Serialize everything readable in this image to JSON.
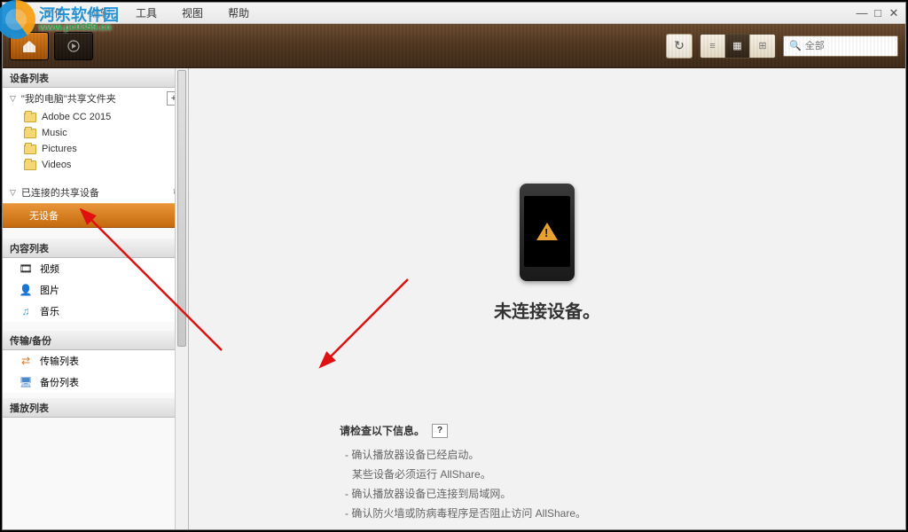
{
  "watermark": {
    "title": "河东软件园",
    "url": "www.pc0359.cn"
  },
  "menu": {
    "file": "文件",
    "edit": "编辑",
    "tools": "工具",
    "view": "视图",
    "help": "帮助"
  },
  "search": {
    "placeholder": "全部"
  },
  "sidebar": {
    "device_list_hdr": "设备列表",
    "my_pc_share": "\"我的电脑\"共享文件夹",
    "folders": [
      "Adobe CC 2015",
      "Music",
      "Pictures",
      "Videos"
    ],
    "connected_hdr": "已连接的共享设备",
    "no_device": "无设备",
    "content_list_hdr": "内容列表",
    "content": {
      "video": "视频",
      "image": "图片",
      "music": "音乐"
    },
    "transfer_hdr": "传输/备份",
    "transfer": {
      "list": "传输列表",
      "backup": "备份列表"
    },
    "playlist_hdr": "播放列表"
  },
  "main": {
    "no_conn": "未连接设备。",
    "check_title": "请检查以下信息。",
    "lines": {
      "l1": "- 确认播放器设备已经启动。",
      "l1b": "某些设备必须运行 AllShare。",
      "l2": "- 确认播放器设备已连接到局域网。",
      "l3": "- 确认防火墙或防病毒程序是否阻止访问 AllShare。"
    }
  }
}
